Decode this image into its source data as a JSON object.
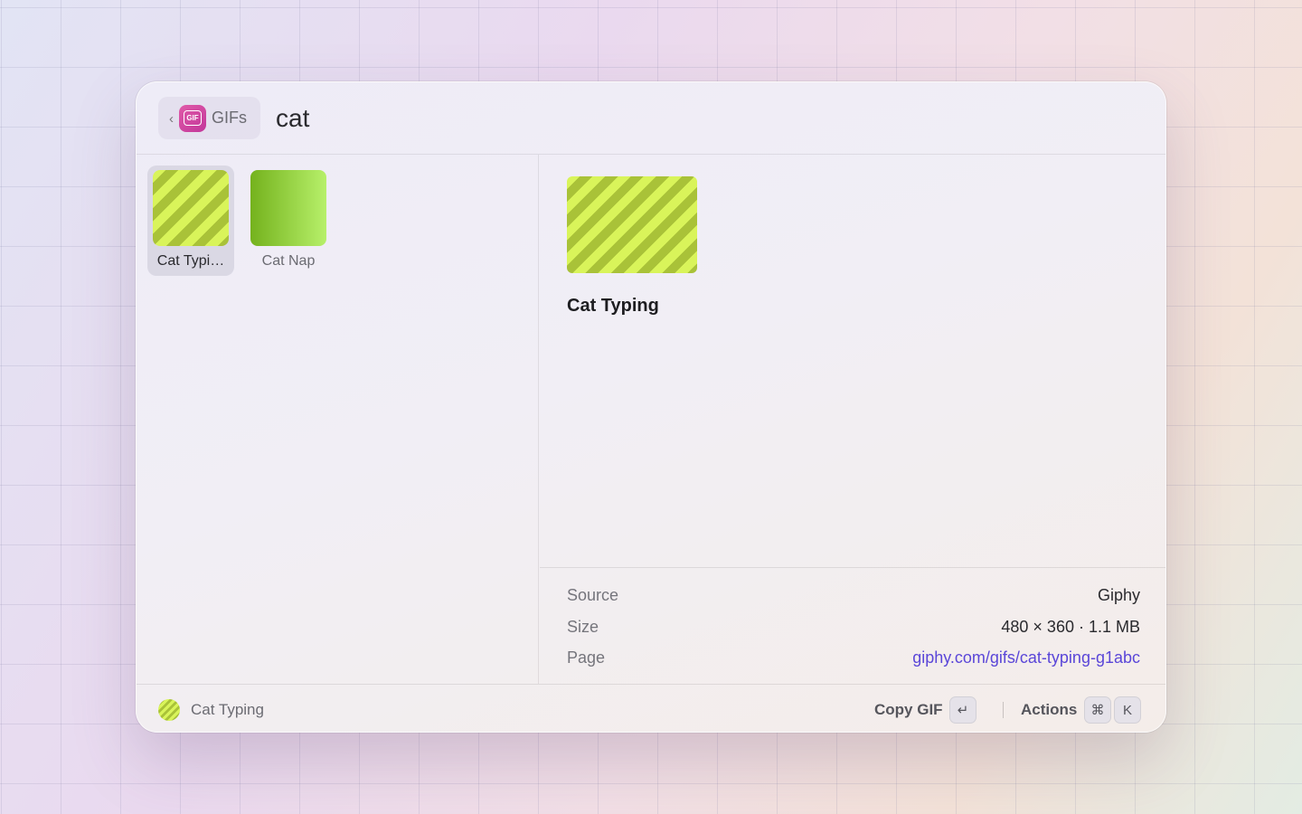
{
  "header": {
    "back_chip_label": "GIFs",
    "back_chevron": "‹",
    "app_icon": "gif-icon",
    "app_icon_text": "GIF",
    "search_query": "cat"
  },
  "results": [
    {
      "title": "Cat Typi…",
      "selected": true
    },
    {
      "title": "Cat Nap",
      "selected": false
    }
  ],
  "detail": {
    "title": "Cat Typing",
    "metadata": [
      {
        "key": "Source",
        "value": "Giphy"
      },
      {
        "key": "Size",
        "value": "480 × 360 · 1.1 MB"
      },
      {
        "key": "Page",
        "value": "giphy.com/gifs/cat-typing-g1abc"
      }
    ]
  },
  "footer": {
    "selected_title": "Cat Typing",
    "primary_action": "Copy GIF",
    "primary_key": "↵",
    "actions_label": "Actions",
    "actions_keys": [
      "⌘",
      "K"
    ]
  },
  "colors": {
    "link": "#5a46d8",
    "gif_badge": "#d04aa2",
    "stripe_light": "#d9f45a",
    "stripe_dark": "#a9c238"
  }
}
